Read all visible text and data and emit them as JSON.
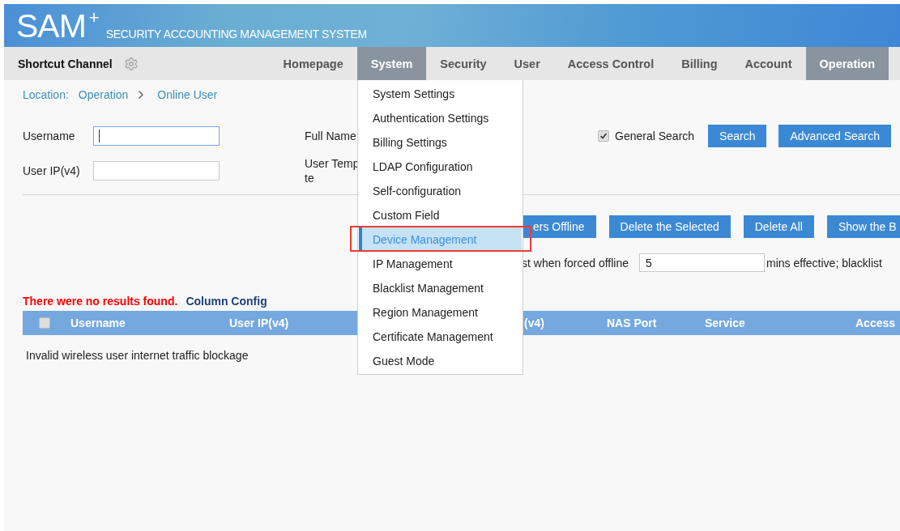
{
  "header": {
    "logo": "SAM",
    "logo_mark": "+",
    "subtitle": "SECURITY ACCOUNTING MANAGEMENT SYSTEM"
  },
  "nav": {
    "shortcut": "Shortcut Channel",
    "items": [
      {
        "label": "Homepage",
        "highlighted": false
      },
      {
        "label": "System",
        "highlighted": true
      },
      {
        "label": "Security",
        "highlighted": false
      },
      {
        "label": "User",
        "highlighted": false
      },
      {
        "label": "Access Control",
        "highlighted": false
      },
      {
        "label": "Billing",
        "highlighted": false
      },
      {
        "label": "Account",
        "highlighted": false
      },
      {
        "label": "Operation",
        "highlighted": true
      }
    ]
  },
  "breadcrumb": {
    "label": "Location:",
    "items": [
      "Operation",
      "Online User"
    ]
  },
  "search_form": {
    "username": {
      "label": "Username",
      "focused": true
    },
    "ip": {
      "label": "User IP(v4)",
      "focused": false
    },
    "full_name": {
      "label": "Full Name"
    },
    "template": {
      "label_lines": [
        "User Temp",
        "te"
      ]
    },
    "general_search": {
      "label": "General Search",
      "checked": true
    },
    "buttons": [
      "Search",
      "Advanced Search"
    ]
  },
  "actions": {
    "buttons": [
      "ers Offline",
      "Delete the Selected",
      "Delete All",
      "Show the B"
    ]
  },
  "blacklist": {
    "text_before": "st when forced offline",
    "value": "5",
    "text_after": "mins effective; blacklist"
  },
  "results": {
    "message": "There were no results found.",
    "link": "Column Config"
  },
  "table": {
    "select_all_checked": false,
    "columns": [
      "Username",
      "User IP(v4)",
      "(v4)",
      "NAS Port",
      "Service",
      "Access"
    ]
  },
  "note": "Invalid wireless user internet traffic blockage",
  "dropdown": {
    "items": [
      {
        "label": "System Settings",
        "selected": false
      },
      {
        "label": "Authentication Settings",
        "selected": false
      },
      {
        "label": "Billing Settings",
        "selected": false
      },
      {
        "label": "LDAP Configuration",
        "selected": false
      },
      {
        "label": "Self-configuration",
        "selected": false
      },
      {
        "label": "Custom Field",
        "selected": false
      },
      {
        "label": "Device Management",
        "selected": true
      },
      {
        "label": "IP Management",
        "selected": false
      },
      {
        "label": "Blacklist Management",
        "selected": false
      },
      {
        "label": "Region Management",
        "selected": false
      },
      {
        "label": "Certificate Management",
        "selected": false
      },
      {
        "label": "Guest Mode",
        "selected": false
      }
    ]
  }
}
